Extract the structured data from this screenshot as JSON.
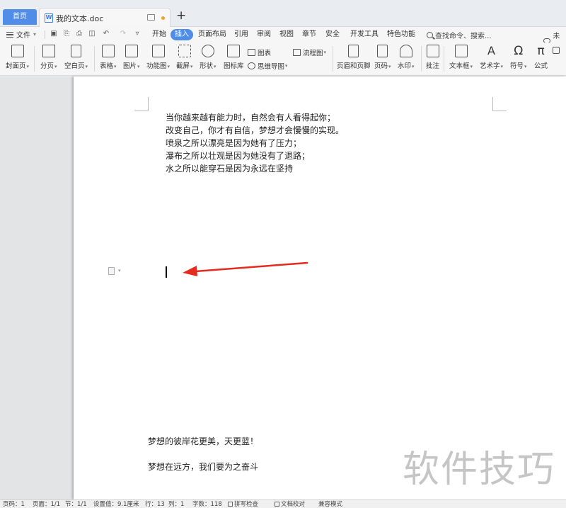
{
  "tabs": {
    "home": "首页",
    "document": "我的文本.doc",
    "add": "+"
  },
  "menubar": {
    "file": "文件",
    "tabs": [
      "开始",
      "插入",
      "页面布局",
      "引用",
      "审阅",
      "视图",
      "章节",
      "安全",
      "开发工具",
      "特色功能"
    ],
    "active_tab": "插入",
    "search": "查找命令、搜索...",
    "cloud": "未同"
  },
  "ribbon": {
    "cover": "封面页",
    "pagebreak": "分页",
    "blankpage": "空白页",
    "table": "表格",
    "picture": "图片",
    "funcchart": "功能图",
    "screenshot": "截屏",
    "shape": "形状",
    "iconlib": "图标库",
    "chart": "图表",
    "mindmap": "思维导图",
    "flowchart": "流程图",
    "header_footer": "页眉和页脚",
    "pagenum": "页码",
    "watermark": "水印",
    "comment": "批注",
    "textbox": "文本框",
    "wordart": "艺术字",
    "symbol": "符号",
    "formula": "公式"
  },
  "document": {
    "lines": [
      "当你越来越有能力时，自然会有人看得起你；",
      "改变自己，你才有自信，梦想才会慢慢的实现。",
      "喷泉之所以漂亮是因为她有了压力；",
      "瀑布之所以壮观是因为她没有了退路；",
      "水之所以能穿石是因为永远在坚持"
    ],
    "footer_line1": "梦想的彼岸花更美，天更蓝！",
    "footer_line2": "梦想在远方，我们要为之奋斗"
  },
  "watermark_text": "软件技巧",
  "statusbar": {
    "page_num": "页码：1",
    "page": "页面：1/1",
    "section": "节：1/1",
    "setting": "设置值：9.1厘米",
    "row": "行：13",
    "col": "列：1",
    "words": "字数：118",
    "spellcheck": "拼写检查",
    "proofread": "文档校对",
    "compat": "兼容模式"
  },
  "colors": {
    "accent": "#4f8de8",
    "arrow": "#e52a1f"
  }
}
